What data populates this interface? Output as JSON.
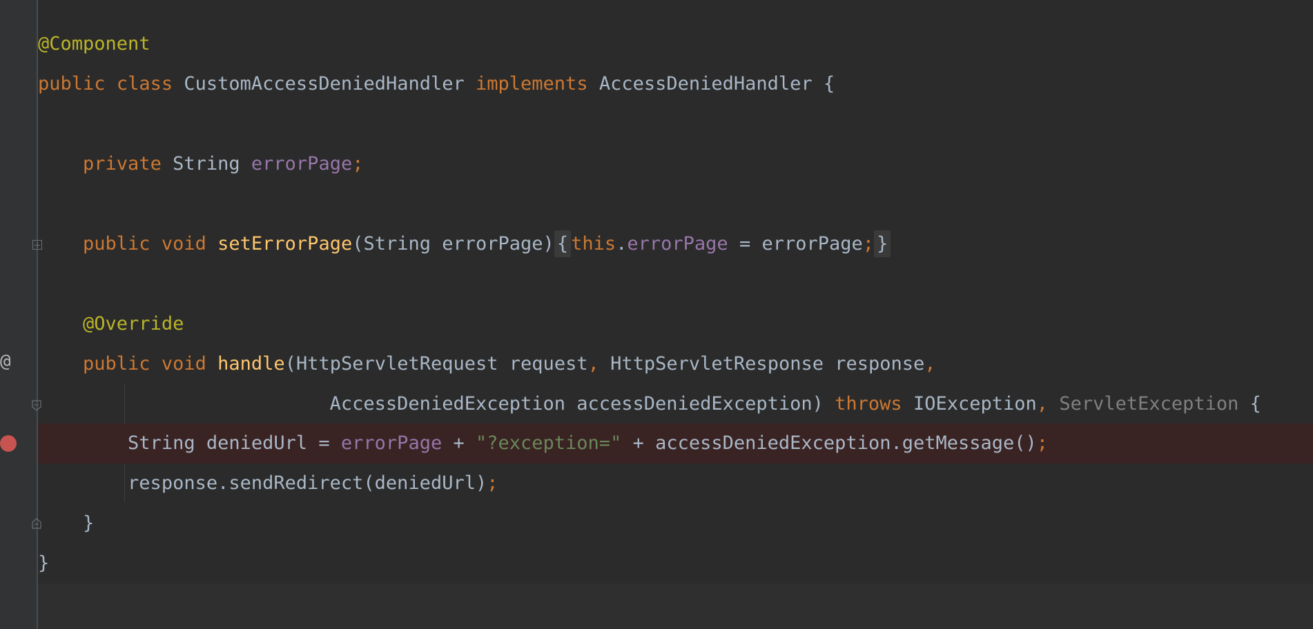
{
  "editor": {
    "lines": {
      "l1": {
        "annotation": "@Component"
      },
      "l2": {
        "kw_public": "public",
        "kw_class": "class",
        "class_name": "CustomAccessDeniedHandler",
        "kw_implements": "implements",
        "interface_name": "AccessDeniedHandler",
        "brace": "{"
      },
      "l4": {
        "kw_private": "private",
        "type": "String",
        "field": "errorPage",
        "semi": ";"
      },
      "l6": {
        "kw_public": "public",
        "kw_void": "void",
        "method": "setErrorPage",
        "params": "(String errorPage)",
        "open_brace": "{",
        "kw_this": "this",
        "dot": ".",
        "field": "errorPage",
        "assign": " = errorPage",
        "semi": ";",
        "close_brace": "}"
      },
      "l8": {
        "annotation": "@Override"
      },
      "l9": {
        "kw_public": "public",
        "kw_void": "void",
        "method": "handle",
        "params_a": "(HttpServletRequest request",
        "comma1": ",",
        "params_b": " HttpServletResponse response",
        "comma2": ","
      },
      "l10": {
        "params": "AccessDeniedException accessDeniedException)",
        "kw_throws": "throws",
        "exc1": "IOException",
        "comma": ",",
        "exc2": "ServletException",
        "brace": "{"
      },
      "l11": {
        "decl": "String deniedUrl = ",
        "field": "errorPage",
        "plus1": " + ",
        "string": "\"?exception=\"",
        "rest": " + accessDeniedException.getMessage()",
        "semi": ";"
      },
      "l12": {
        "call": "response.sendRedirect(deniedUrl)",
        "semi": ";"
      },
      "l13": {
        "brace": "}"
      },
      "l14": {
        "brace": "}"
      }
    }
  },
  "gutter": {
    "override_marker": "@",
    "breakpoint_color": "#c75450"
  },
  "colors": {
    "background": "#2b2b2b",
    "keyword": "#cc7832",
    "annotation": "#bbb529",
    "field": "#9876aa",
    "method": "#ffc66d",
    "string": "#6a8759",
    "default_text": "#a9b7c6"
  }
}
